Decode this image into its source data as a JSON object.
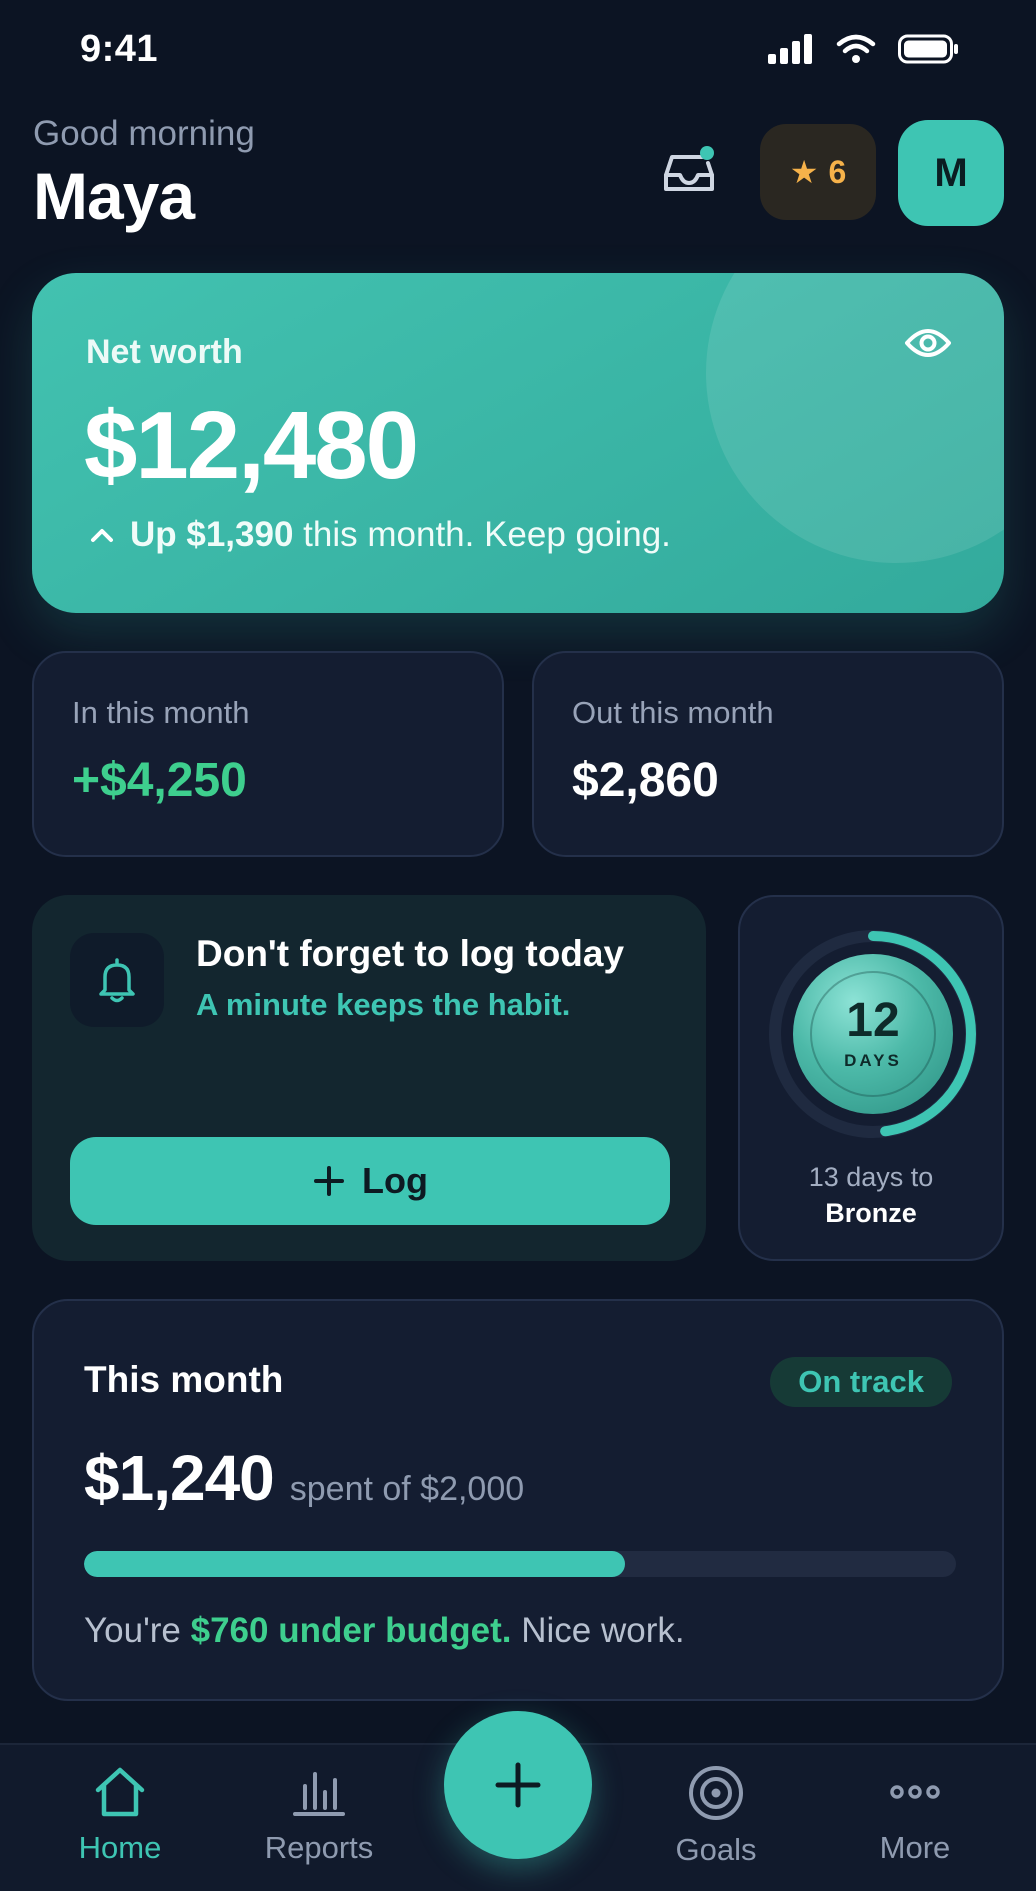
{
  "status_bar": {
    "time": "9:41"
  },
  "header": {
    "greeting": "Good morning",
    "name": "Maya",
    "stars_count": "6",
    "avatar_initial": "M"
  },
  "net_worth": {
    "label": "Net worth",
    "value": "$12,480",
    "trend_amount": "Up $1,390",
    "trend_text": "this month. Keep going."
  },
  "cashflow": {
    "in_label": "In this month",
    "in_value": "+$4,250",
    "out_label": "Out this month",
    "out_value": "$2,860"
  },
  "reminder": {
    "title": "Don't forget to log today",
    "subtitle": "A minute keeps the habit.",
    "button_label": "Log"
  },
  "streak": {
    "days": "12",
    "unit": "DAYS",
    "progress_fraction": 0.48,
    "next_text": "13 days to",
    "next_level": "Bronze"
  },
  "budget": {
    "title": "This month",
    "status": "On track",
    "spent": "$1,240",
    "of_text": "spent of $2,000",
    "progress_fraction": 0.62,
    "note_prefix": "You're",
    "note_highlight": "$760 under budget.",
    "note_suffix": "Nice work."
  },
  "nav": {
    "home": "Home",
    "reports": "Reports",
    "goals": "Goals",
    "more": "More"
  },
  "colors": {
    "background": "#0c1423",
    "accent": "#3ec5b3",
    "positive": "#3ecf8e",
    "star": "#f6b24a"
  },
  "icons": [
    "signal-icon",
    "wifi-icon",
    "battery-icon",
    "inbox-icon",
    "star-icon",
    "eye-icon",
    "chevron-up-icon",
    "bell-icon",
    "plus-icon",
    "home-icon",
    "bar-chart-icon",
    "target-icon",
    "more-icon"
  ]
}
